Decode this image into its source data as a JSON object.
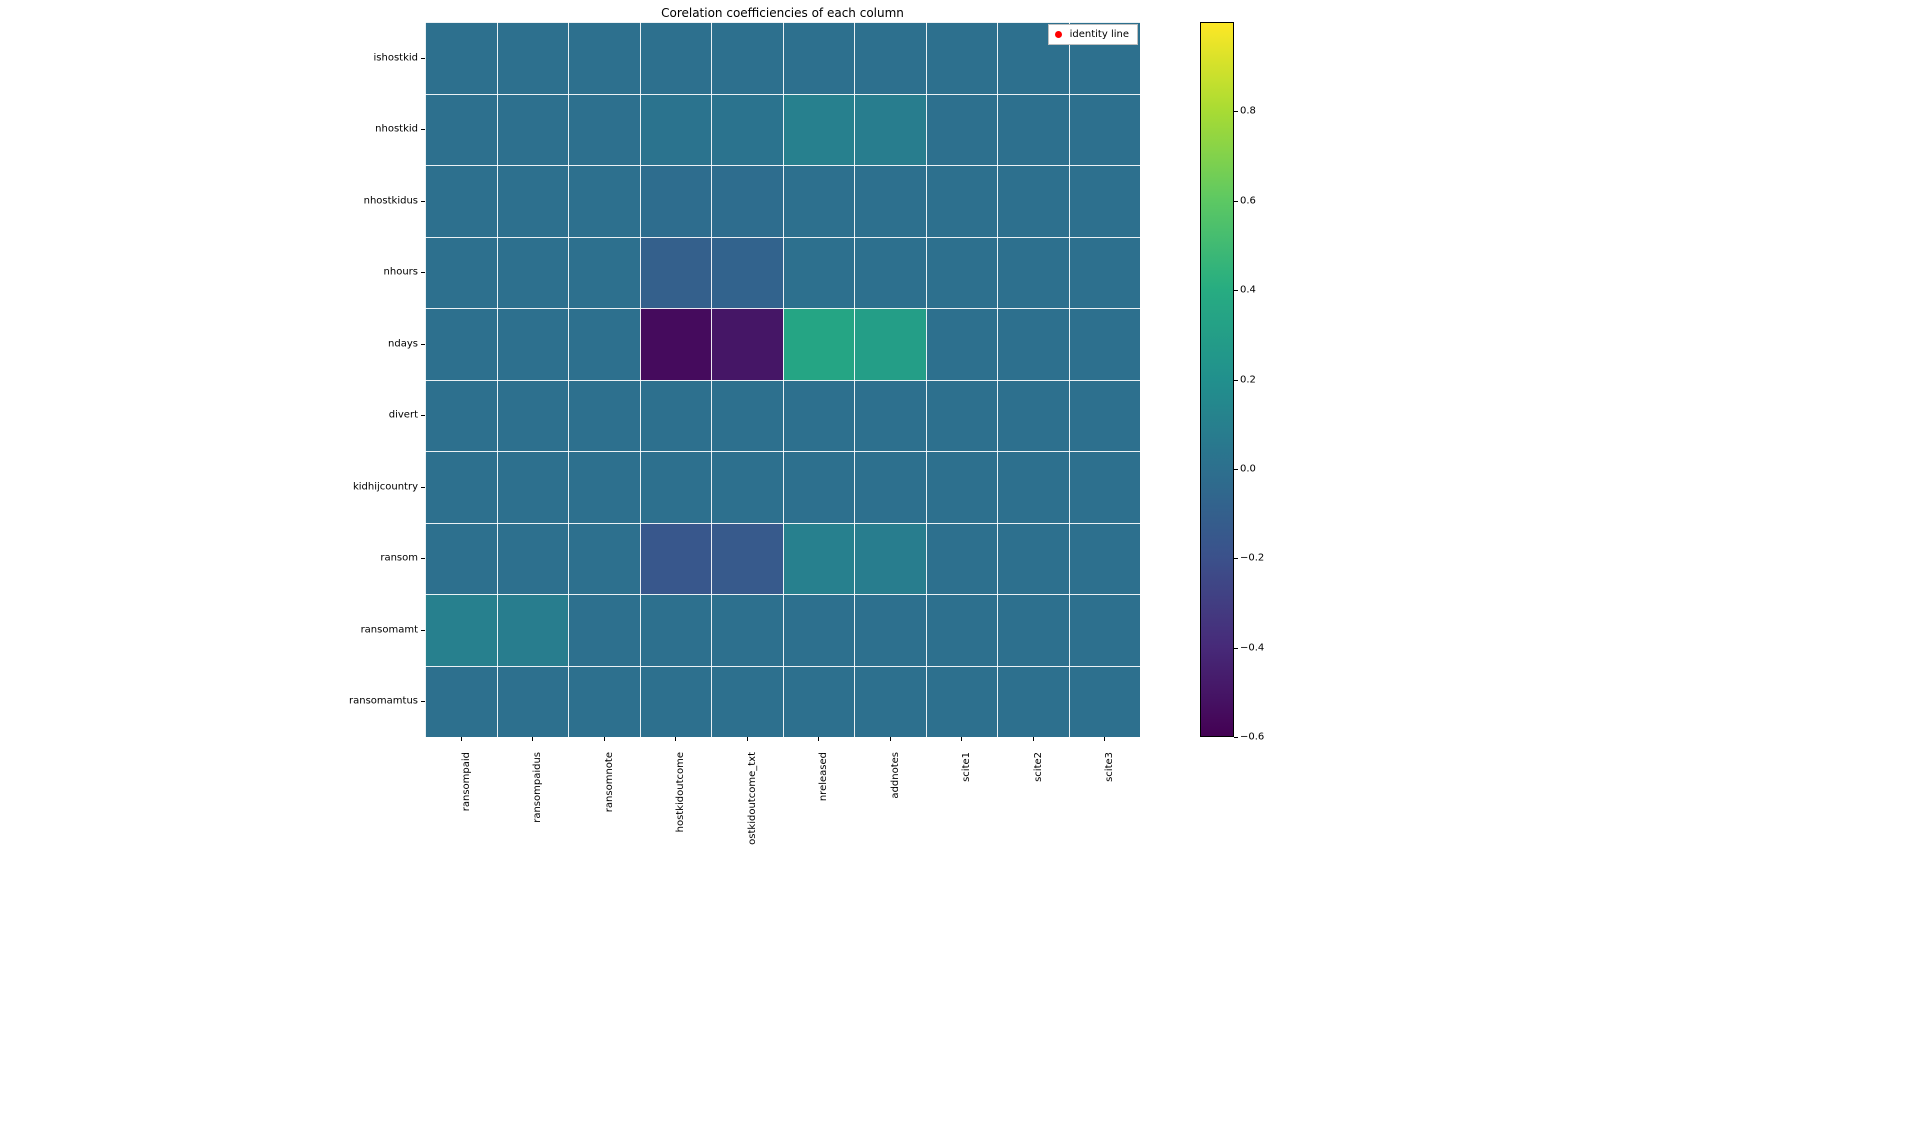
{
  "chart_data": {
    "type": "heatmap",
    "title": "Corelation coefficiencies of each column",
    "legend": {
      "label": "identity line",
      "marker_color": "#ff0000"
    },
    "y_categories": [
      "ishostkid",
      "nhostkid",
      "nhostkidus",
      "nhours",
      "ndays",
      "divert",
      "kidhijcountry",
      "ransom",
      "ransomamt",
      "ransomamtus"
    ],
    "x_categories": [
      "ransompaid",
      "ransompaidus",
      "ransomnote",
      "hostkidoutcome",
      "ostkidoutcome_txt",
      "nreleased",
      "addnotes",
      "scite1",
      "scite2",
      "scite3"
    ],
    "vmin": -0.6,
    "vmax": 1.0,
    "colorbar_ticks": [
      -0.6,
      -0.4,
      -0.2,
      0.0,
      0.2,
      0.4,
      0.6,
      0.8
    ],
    "matrix": [
      [
        0.0,
        0.0,
        0.0,
        0.0,
        0.0,
        0.0,
        0.0,
        0.0,
        0.0,
        0.0
      ],
      [
        0.0,
        0.0,
        0.0,
        0.02,
        0.02,
        0.1,
        0.08,
        0.0,
        0.0,
        0.0
      ],
      [
        0.0,
        0.0,
        0.0,
        -0.02,
        -0.02,
        0.0,
        0.0,
        0.0,
        0.0,
        0.0
      ],
      [
        0.0,
        0.0,
        0.0,
        -0.1,
        -0.08,
        0.0,
        0.0,
        0.0,
        0.0,
        0.0
      ],
      [
        0.0,
        0.0,
        0.0,
        -0.55,
        -0.5,
        0.35,
        0.3,
        0.0,
        0.0,
        0.0
      ],
      [
        0.0,
        0.0,
        0.0,
        0.0,
        0.0,
        0.0,
        0.0,
        0.0,
        0.0,
        0.0
      ],
      [
        0.0,
        0.0,
        0.0,
        0.0,
        0.0,
        0.0,
        0.0,
        0.0,
        0.0,
        0.0
      ],
      [
        0.0,
        0.0,
        0.0,
        -0.16,
        -0.14,
        0.1,
        0.08,
        0.0,
        0.0,
        0.0
      ],
      [
        0.1,
        0.08,
        0.0,
        0.0,
        0.0,
        0.0,
        0.0,
        0.0,
        0.0,
        0.0
      ],
      [
        0.0,
        0.0,
        0.0,
        0.0,
        0.0,
        0.0,
        0.0,
        0.0,
        0.0,
        0.0
      ]
    ],
    "colormap_hint": "viridis"
  }
}
